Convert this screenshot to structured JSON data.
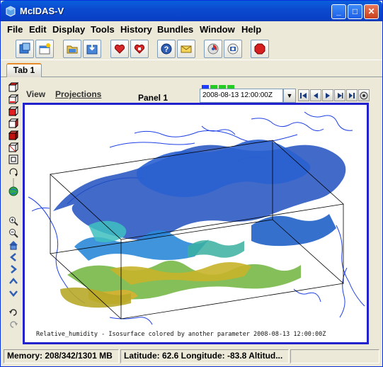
{
  "window": {
    "title": "McIDAS-V",
    "minimize": "_",
    "maximize": "□",
    "close": "✕"
  },
  "menus": [
    "File",
    "Edit",
    "Display",
    "Tools",
    "History",
    "Bundles",
    "Window",
    "Help"
  ],
  "toolbar_icons": [
    "dashboard-icon",
    "new-window-icon",
    "open-bundle-icon",
    "save-bundle-icon",
    "favorite-bundles-icon",
    "manage-favorites-icon",
    "help-icon",
    "support-form-icon",
    "rgb-icon",
    "capture-icon",
    "stop-icon"
  ],
  "tabs": [
    {
      "label": "Tab 1"
    }
  ],
  "panel": {
    "view_menu": "View",
    "projections_menu": "Projections",
    "title": "Panel 1",
    "time": "2008-08-13 12:00:00Z",
    "anim_colors": [
      "#1E3CFF",
      "#22CC22",
      "#22CC22",
      "#22CC22"
    ]
  },
  "display": {
    "caption": "Relative_humidity - Isosurface colored by another parameter 2008-08-13 12:00:00Z"
  },
  "status": {
    "memory": "Memory: 208/342/1301 MB",
    "location": "Latitude:  62.6 Longitude:  -83.8 Altitud..."
  }
}
